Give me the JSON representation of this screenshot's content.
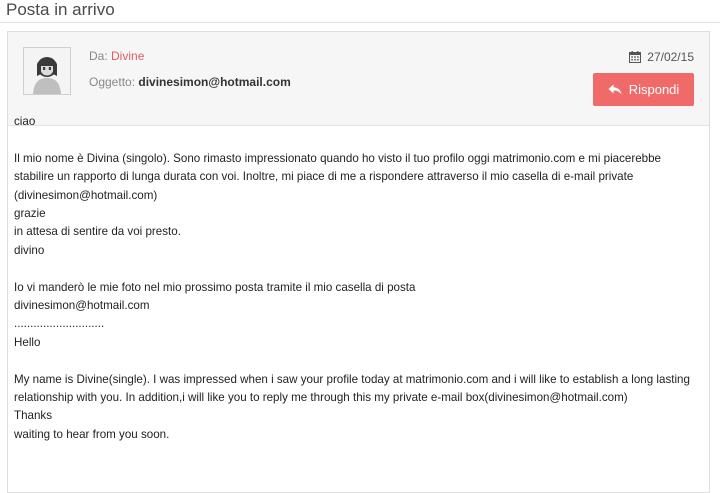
{
  "page": {
    "title": "Posta in arrivo"
  },
  "header": {
    "from_label": "Da: ",
    "from_name": "Divine",
    "subject_label": "Oggetto: ",
    "subject_value": "divinesimon@hotmail.com",
    "date": "27/02/15",
    "reply_label": "Rispondi",
    "icons": {
      "calendar": "calendar-icon",
      "reply": "reply-arrow-icon",
      "avatar": "default-avatar-icon"
    },
    "colors": {
      "accent": "#f06a6a",
      "from_name": "#e05d5d"
    }
  },
  "message": {
    "lines": [
      "ciao",
      "",
      "Il mio nome è Divina (singolo). Sono rimasto impressionato quando ho visto il tuo profilo oggi matrimonio.com e mi piacerebbe",
      "stabilire un rapporto di lunga durata con voi. Inoltre, mi piace di me a rispondere attraverso il mio casella di e-mail private",
      "(divinesimon@hotmail.com)",
      "grazie",
      "in attesa di sentire da voi presto.",
      "divino",
      "",
      "Io vi manderò le mie foto nel mio prossimo posta tramite il mio casella di posta",
      "divinesimon@hotmail.com",
      "............................",
      "Hello",
      "",
      "My name is Divine(single). I was impressed when i saw your profile today at matrimonio.com and i will like to establish a long lasting",
      "relationship with you. In addition,i will like you to reply me through this my private e-mail box(divinesimon@hotmail.com)",
      "Thanks",
      "waiting to hear from you soon."
    ]
  }
}
